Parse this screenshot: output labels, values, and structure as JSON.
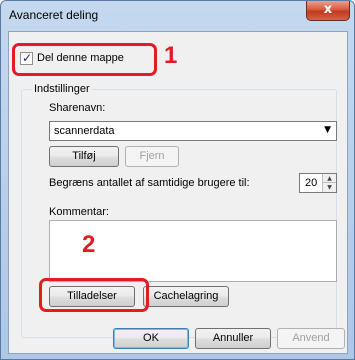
{
  "window": {
    "title": "Avanceret deling",
    "close_glyph": "x"
  },
  "share_checkbox": {
    "label": "Del denne mappe",
    "checked": true
  },
  "settings": {
    "group_label": "Indstillinger",
    "sharename_label": "Sharenavn:",
    "sharename_value": "scannerdata",
    "add_label": "Tilføj",
    "remove_label": "Fjern",
    "limit_label": "Begræns antallet af samtidige brugere til:",
    "limit_value": "20",
    "comment_label": "Kommentar:",
    "permissions_label": "Tilladelser",
    "caching_label": "Cachelagring"
  },
  "footer": {
    "ok_label": "OK",
    "cancel_label": "Annuller",
    "apply_label": "Anvend"
  },
  "annotations": {
    "callout_1": "1",
    "callout_2": "2",
    "callout_color": "#e31b23"
  },
  "icons": {
    "checkmark": "check-icon",
    "combo_arrow": "chevron-down-icon",
    "spin_up": "spin-up-icon",
    "spin_down": "spin-down-icon"
  }
}
